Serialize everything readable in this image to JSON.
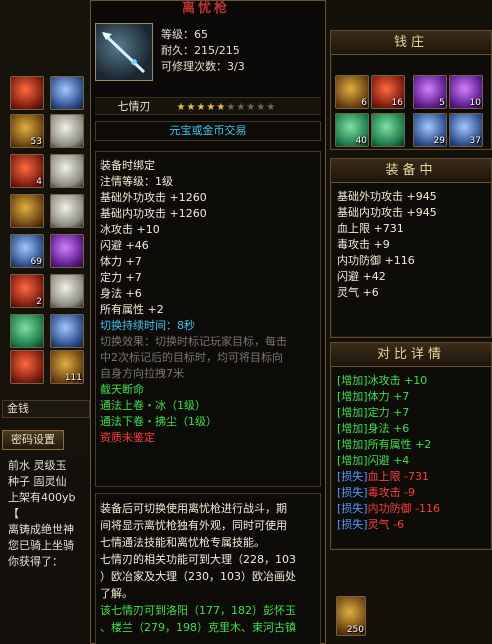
{
  "item": {
    "name": "离忧枪",
    "level_text": "等级：65",
    "durability_text": "耐久：215/215",
    "repairs_text": "可修理次数：3/3",
    "mastery_label": "七情刃",
    "stars_total": 10,
    "stars_filled": 5,
    "trade_text": "元宝或金币交易",
    "lines": [
      {
        "text": "装备时绑定",
        "cls": "wht"
      },
      {
        "text": "注情等级：1级",
        "cls": "wht"
      },
      {
        "text": "基础外功攻击 +1260",
        "cls": "wht"
      },
      {
        "text": "基础内功攻击 +1260",
        "cls": "wht"
      },
      {
        "text": "冰攻击 +10",
        "cls": "wht"
      },
      {
        "text": "闪避 +46",
        "cls": "wht"
      },
      {
        "text": "体力 +7",
        "cls": "wht"
      },
      {
        "text": "定力 +7",
        "cls": "wht"
      },
      {
        "text": "身法 +6",
        "cls": "wht"
      },
      {
        "text": "所有属性 +2",
        "cls": "wht"
      },
      {
        "text": "切换持续时间：8秒",
        "cls": "cyan"
      },
      {
        "text": "切换效果：切换时标记玩家目标，每击",
        "cls": "gray"
      },
      {
        "text": "中2次标记后的目标时，均可将目标向",
        "cls": "gray"
      },
      {
        "text": "自身方向拉拽7米",
        "cls": "gray"
      },
      {
        "text": "截天断命",
        "cls": "grn"
      },
      {
        "text": "通法上卷・冰（1级）",
        "cls": "grn"
      },
      {
        "text": "通法下卷・拂尘（1级）",
        "cls": "grn"
      },
      {
        "text": "资质未鉴定",
        "cls": "red"
      }
    ],
    "desc_lines": [
      "装备后可切换使用离忧枪进行战斗，期",
      "间将显示离忧枪独有外观，同时可使用",
      "七情通法技能和离忧枪专属技能。",
      "七情刃的相关功能可到大理（228，103",
      "）欧冶家及大理（230，103）欧冶画处",
      "了解。"
    ],
    "desc_tail_lines": [
      "该七情刃可到洛阳（177，182）彭怀玉",
      "、楼兰（279，198）克里木、束河古镇"
    ]
  },
  "shop": {
    "title": "钱庄"
  },
  "equipped": {
    "title": "装备中",
    "lines": [
      "基础外功攻击 +945",
      "基础内功攻击 +945",
      "血上限 +731",
      "毒攻击 +9",
      "内功防御 +116",
      "闪避 +42",
      "灵气 +6"
    ]
  },
  "compare": {
    "title": "对比详情",
    "rows": [
      {
        "tag": "[增加]",
        "text": "冰攻击 +10",
        "type": "up"
      },
      {
        "tag": "[增加]",
        "text": "体力 +7",
        "type": "up"
      },
      {
        "tag": "[增加]",
        "text": "定力 +7",
        "type": "up"
      },
      {
        "tag": "[增加]",
        "text": "身法 +6",
        "type": "up"
      },
      {
        "tag": "[增加]",
        "text": "所有属性 +2",
        "type": "up"
      },
      {
        "tag": "[增加]",
        "text": "闪避 +4",
        "type": "up"
      },
      {
        "tag": "[损失]",
        "text": "血上限 -731",
        "type": "down"
      },
      {
        "tag": "[损失]",
        "text": "毒攻击 -9",
        "type": "down"
      },
      {
        "tag": "[损失]",
        "text": "内功防御 -116",
        "type": "down"
      },
      {
        "tag": "[损失]",
        "text": "灵气 -6",
        "type": "down"
      }
    ]
  },
  "left": {
    "counts": [
      "53",
      "4",
      "69",
      "2",
      "111"
    ],
    "money_label": "金钱",
    "password_btn": "密码设置",
    "chat": [
      "前水 灵级玉",
      "种子 固灵仙",
      "上架有400yb",
      "【 ",
      "离铸成绝世神",
      "您已骑上坐骑",
      "你获得了："
    ]
  },
  "right_counts": {
    "row1": [
      "6",
      "16",
      "5",
      "10"
    ],
    "row2": [
      "40",
      "29",
      "37"
    ],
    "bottom": "250"
  }
}
